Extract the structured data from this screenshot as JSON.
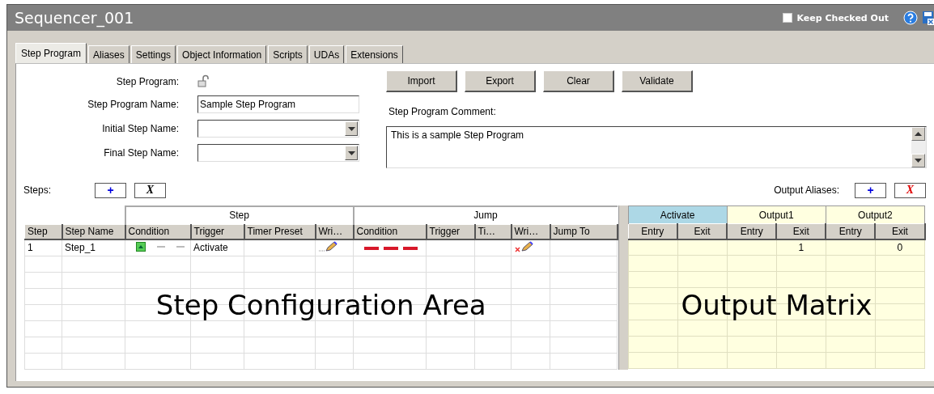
{
  "window": {
    "title": "Sequencer_001",
    "keep_checked_out": {
      "label": "Keep Checked Out",
      "checked": false
    }
  },
  "tabs": [
    {
      "label": "Step Program",
      "selected": true
    },
    {
      "label": "Aliases",
      "selected": false
    },
    {
      "label": "Settings",
      "selected": false
    },
    {
      "label": "Object Information",
      "selected": false
    },
    {
      "label": "Scripts",
      "selected": false
    },
    {
      "label": "UDAs",
      "selected": false
    },
    {
      "label": "Extensions",
      "selected": false
    }
  ],
  "form": {
    "step_program_label": "Step Program:",
    "fields": [
      {
        "label": "Step Program Name:",
        "kind": "text",
        "value": "Sample Step Program"
      },
      {
        "label": "Initial Step Name:",
        "kind": "dropdown"
      },
      {
        "label": "Final Step Name:",
        "kind": "dropdown"
      }
    ],
    "buttons": [
      "Import",
      "Export",
      "Clear",
      "Validate"
    ],
    "comment_label": "Step Program Comment:",
    "comment": "This is a sample Step Program"
  },
  "steps": {
    "label": "Steps:",
    "add_button": "+",
    "delete_button": "X",
    "ungrouped_columns": [
      "Step",
      "Step Name"
    ],
    "groups": [
      {
        "label": "Step",
        "columns": [
          "Condition",
          "Trigger",
          "Timer Preset",
          "Wri…"
        ]
      },
      {
        "label": "Jump",
        "columns": [
          "Condition",
          "Trigger",
          "Ti…",
          "Wri…",
          "Jump To"
        ]
      }
    ],
    "rows": [
      {
        "step": "1",
        "step_name": "Step_1",
        "trigger": "Activate",
        "step_write": true,
        "jump_write": false
      }
    ],
    "area_label": "Step Configuration Area"
  },
  "output_aliases": {
    "label": "Output Aliases:",
    "add_button": "+",
    "delete_button": "X",
    "outputs": [
      {
        "name": "Activate",
        "selected": true,
        "columns": [
          "Entry",
          "Exit"
        ]
      },
      {
        "name": "Output1",
        "selected": false,
        "columns": [
          "Entry",
          "Exit"
        ],
        "exit": "1"
      },
      {
        "name": "Output2",
        "selected": false,
        "columns": [
          "Entry",
          "Exit"
        ],
        "exit": "0"
      }
    ],
    "area_label": "Output Matrix"
  }
}
